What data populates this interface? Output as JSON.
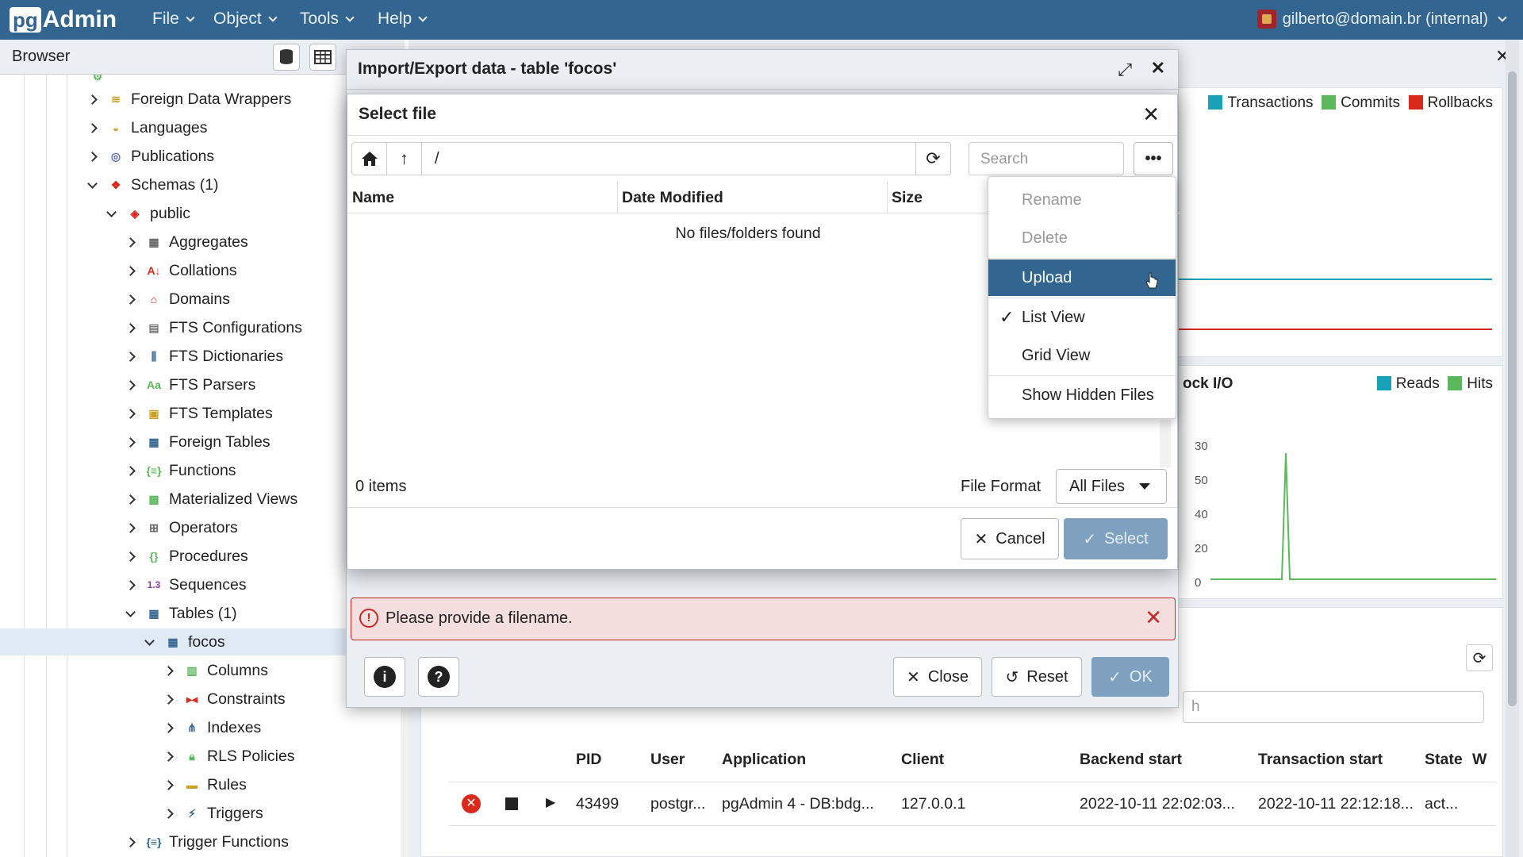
{
  "app": {
    "logo_pg": "pg",
    "logo_admin": "Admin"
  },
  "menu": {
    "file": "File",
    "object": "Object",
    "tools": "Tools",
    "help": "Help"
  },
  "user": {
    "label": "gilberto@domain.br (internal)"
  },
  "browser": {
    "title": "Browser",
    "tree": [
      {
        "label": "Foreign Data Wrappers"
      },
      {
        "label": "Languages"
      },
      {
        "label": "Publications"
      },
      {
        "label": "Schemas (1)"
      },
      {
        "label": "public"
      },
      {
        "label": "Aggregates"
      },
      {
        "label": "Collations"
      },
      {
        "label": "Domains"
      },
      {
        "label": "FTS Configurations"
      },
      {
        "label": "FTS Dictionaries"
      },
      {
        "label": "FTS Parsers",
        "icon_text": "Aa"
      },
      {
        "label": "FTS Templates"
      },
      {
        "label": "Foreign Tables"
      },
      {
        "label": "Functions"
      },
      {
        "label": "Materialized Views"
      },
      {
        "label": "Operators"
      },
      {
        "label": "Procedures"
      },
      {
        "label": "Sequences",
        "icon_text": "1.3"
      },
      {
        "label": "Tables (1)"
      },
      {
        "label": "focos"
      },
      {
        "label": "Columns"
      },
      {
        "label": "Constraints"
      },
      {
        "label": "Indexes"
      },
      {
        "label": "RLS Policies"
      },
      {
        "label": "Rules"
      },
      {
        "label": "Triggers"
      },
      {
        "label": "Trigger Functions"
      }
    ]
  },
  "dashboard": {
    "tx_legend": [
      "Transactions",
      "Commits",
      "Rollbacks"
    ],
    "blockio_title": "ock I/O",
    "blockio_legend": [
      "Reads",
      "Hits"
    ],
    "blockio_ticks": [
      "30",
      "50",
      "40",
      "20",
      "0"
    ],
    "search_placeholder": "h",
    "activity": {
      "headers": [
        "PID",
        "User",
        "Application",
        "Client",
        "Backend start",
        "Transaction start",
        "State",
        "W"
      ],
      "row": [
        "43499",
        "postgr...",
        "pgAdmin 4 - DB:bdg...",
        "127.0.0.1",
        "2022-10-11 22:02:03...",
        "2022-10-11 22:12:18...",
        "act..."
      ]
    }
  },
  "import_dialog": {
    "title": "Import/Export data - table 'focos'",
    "error": "Please provide a filename.",
    "close": "Close",
    "reset": "Reset",
    "ok": "OK"
  },
  "select_file": {
    "title": "Select file",
    "path": "/",
    "search_placeholder": "Search",
    "columns": [
      "Name",
      "Date Modified",
      "Size"
    ],
    "empty": "No files/folders found",
    "items_count": "0 items",
    "file_format_label": "File Format",
    "file_format_value": "All Files",
    "cancel": "Cancel",
    "select": "Select"
  },
  "options_menu": {
    "rename": "Rename",
    "delete": "Delete",
    "upload": "Upload",
    "list_view": "List View",
    "grid_view": "Grid View",
    "show_hidden": "Show Hidden Files"
  },
  "colors": {
    "brand": "#326690",
    "error_bg": "#f5dede",
    "error": "#c62828",
    "tx": "#17a2b8",
    "commits": "#5cb85c",
    "rollbacks": "#d9291c"
  }
}
